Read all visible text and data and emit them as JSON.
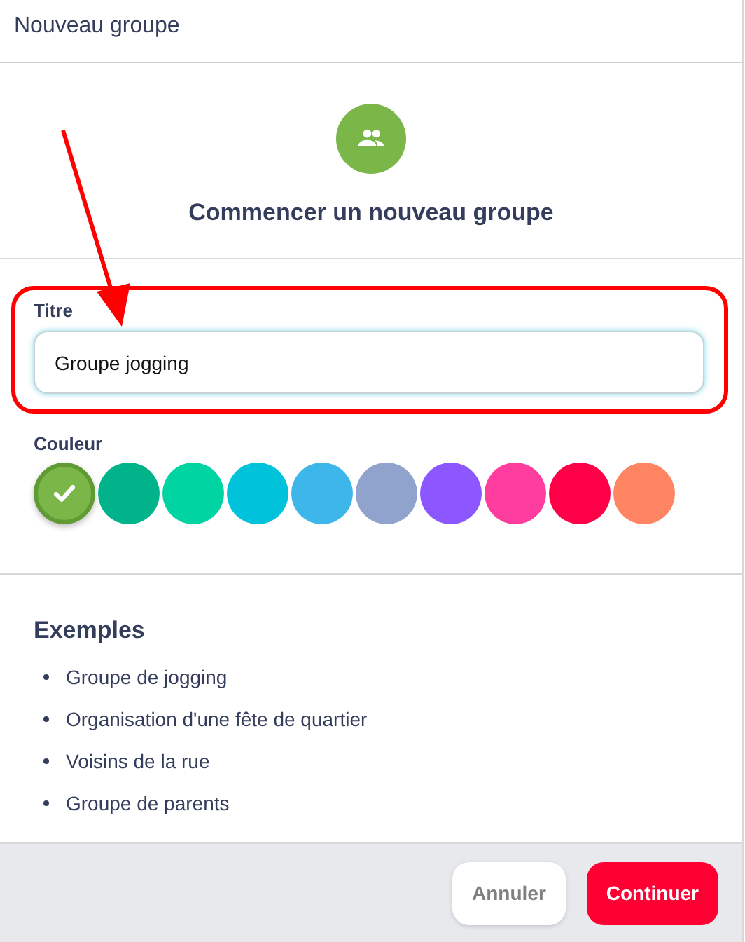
{
  "window": {
    "title": "Nouveau groupe"
  },
  "intro": {
    "heading": "Commencer un nouveau groupe"
  },
  "title_field": {
    "label": "Titre",
    "value": "Groupe jogging"
  },
  "color_picker": {
    "label": "Couleur",
    "colors": [
      {
        "color": "#7ab648",
        "selected": true
      },
      {
        "color": "#00b38a",
        "selected": false
      },
      {
        "color": "#00d4a3",
        "selected": false
      },
      {
        "color": "#00c2db",
        "selected": false
      },
      {
        "color": "#3db7ea",
        "selected": false
      },
      {
        "color": "#8fa3cc",
        "selected": false
      },
      {
        "color": "#8c57ff",
        "selected": false
      },
      {
        "color": "#ff3d9e",
        "selected": false
      },
      {
        "color": "#ff0048",
        "selected": false
      },
      {
        "color": "#ff8462",
        "selected": false
      }
    ]
  },
  "examples": {
    "heading": "Exemples",
    "items": [
      "Groupe de jogging",
      "Organisation d'une fête de quartier",
      "Voisins de la rue",
      "Groupe de parents"
    ]
  },
  "buttons": [
    {
      "label": "Annuler",
      "kind": "secondary"
    },
    {
      "label": "Continuer",
      "kind": "primary"
    }
  ]
}
